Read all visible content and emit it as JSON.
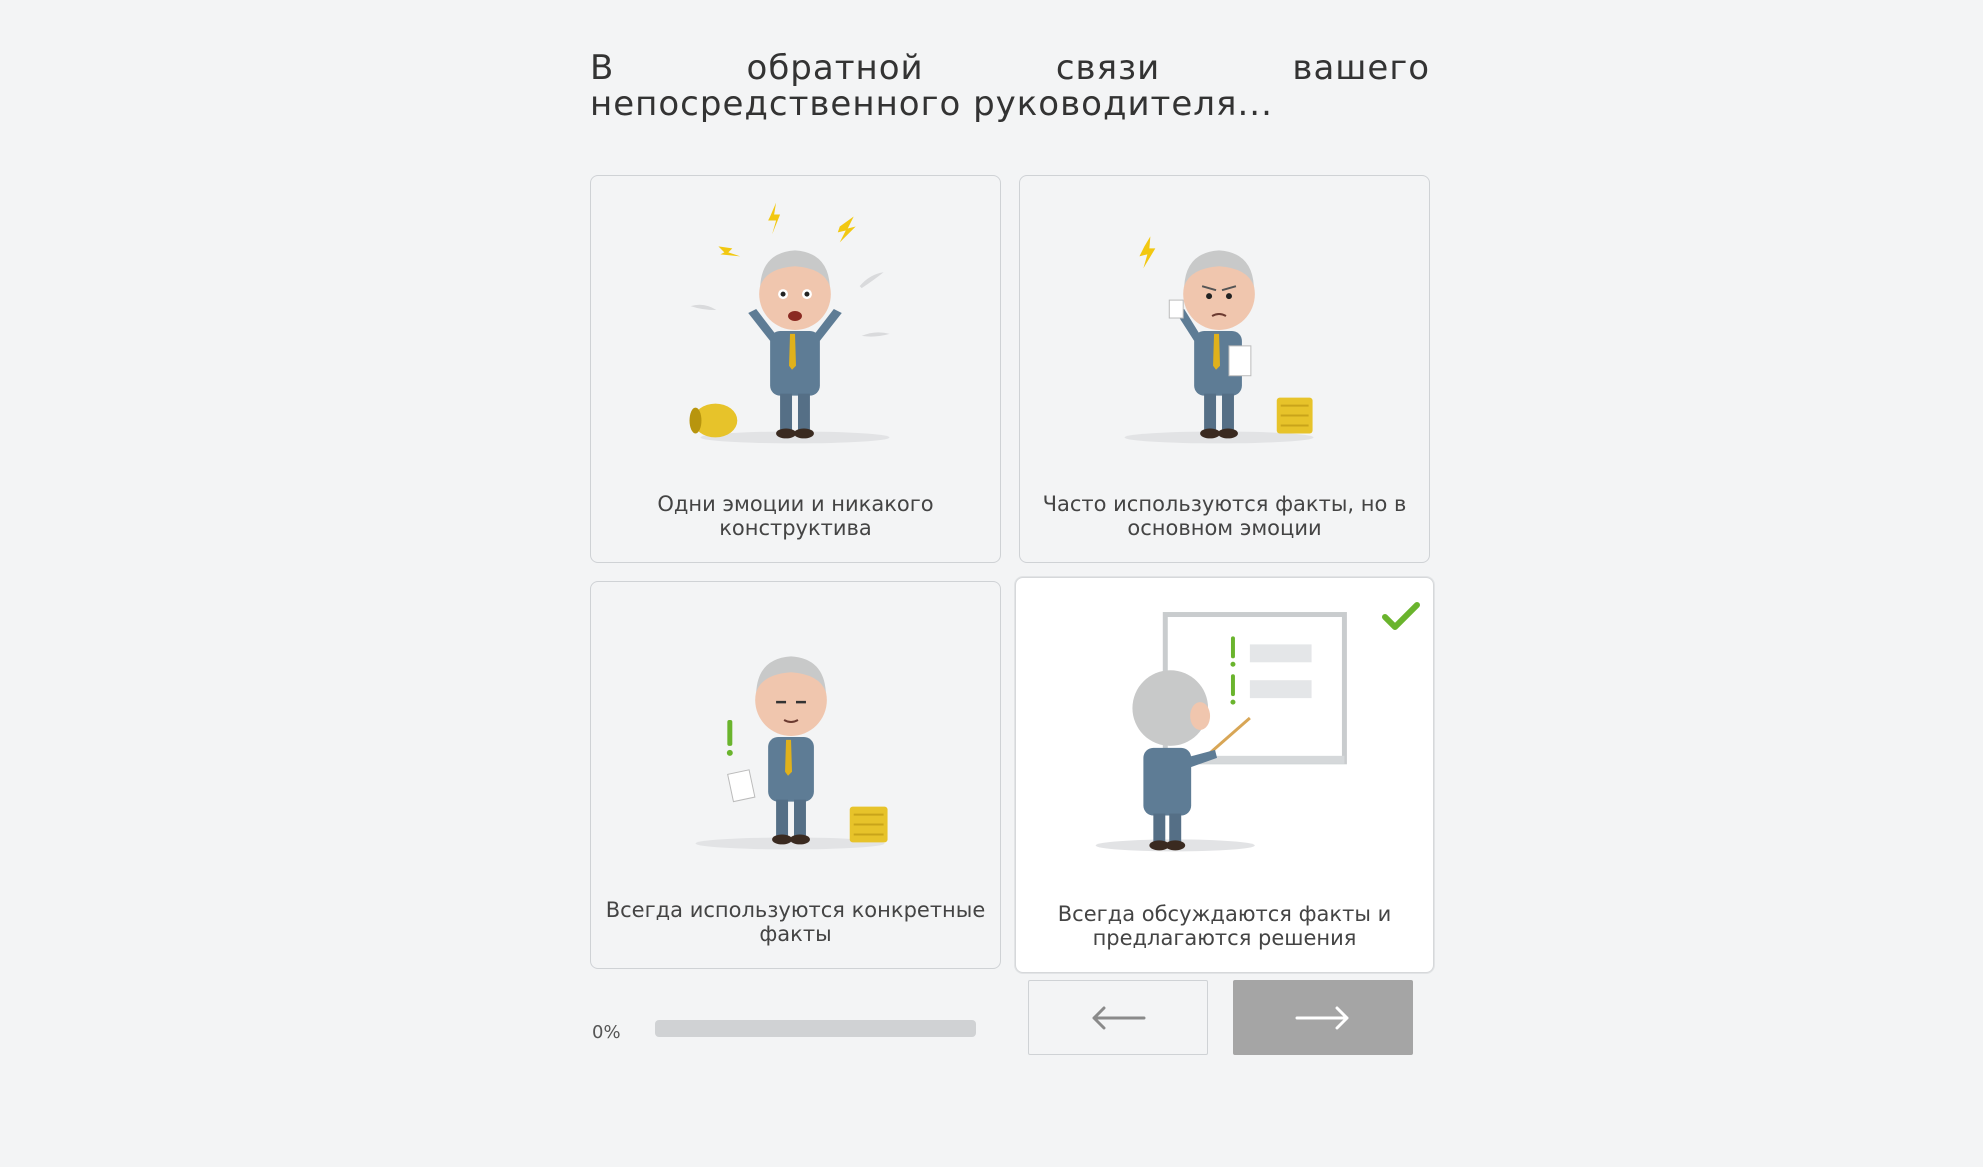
{
  "question": "В обратной связи вашего непосредственного руководителя...",
  "options": [
    {
      "label": "Одни эмоции и никакого конструктива",
      "selected": false
    },
    {
      "label": "Часто используются факты, но в основном эмоции",
      "selected": false
    },
    {
      "label": "Всегда используются конкретные факты",
      "selected": false
    },
    {
      "label": "Всегда обсуждаются факты и предлагаются решения",
      "selected": true
    }
  ],
  "progress": {
    "label": "0%",
    "value": 0
  },
  "navigation": {
    "prev_icon": "arrow-left-icon",
    "next_icon": "arrow-right-icon"
  },
  "colors": {
    "accent": "#6ab42d",
    "next_button": "#a5a5a5",
    "background": "#f3f4f5"
  }
}
